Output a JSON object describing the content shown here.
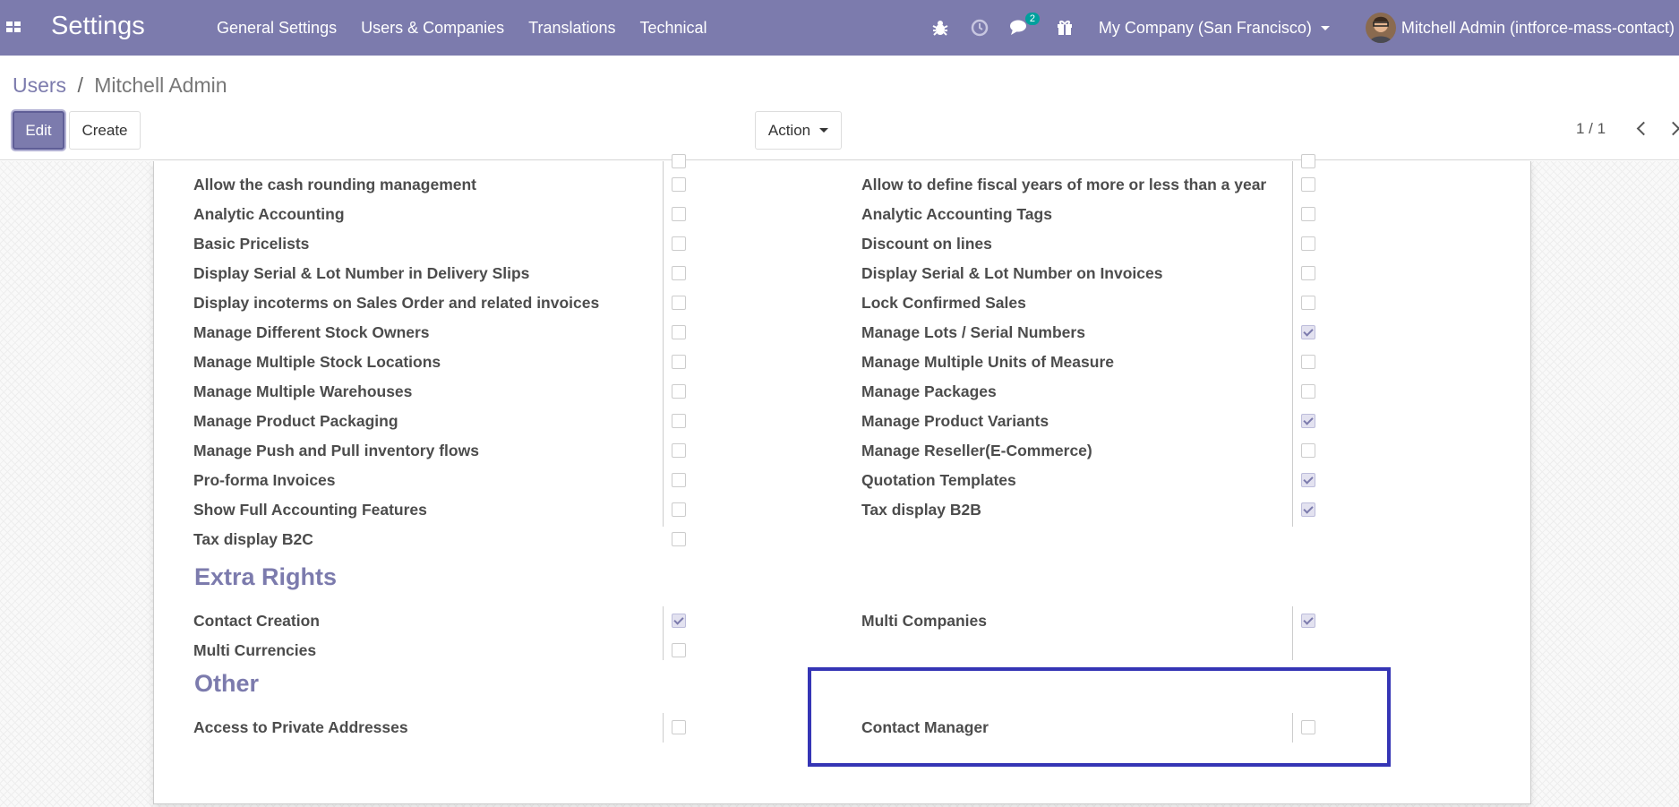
{
  "navbar": {
    "brand": "Settings",
    "menu": [
      "General Settings",
      "Users & Companies",
      "Translations",
      "Technical"
    ],
    "messages_badge": "2",
    "company": "My Company (San Francisco)",
    "user": "Mitchell Admin (intforce-mass-contact)",
    "colors": {
      "navbar_bg": "#7c7bad",
      "badge_bg": "#00a09d"
    }
  },
  "breadcrumb": {
    "parent": "Users",
    "separator": "/",
    "current": "Mitchell Admin"
  },
  "buttons": {
    "edit": "Edit",
    "create": "Create",
    "action": "Action"
  },
  "pager": {
    "value": "1 / 1"
  },
  "technical_left": [
    {
      "label": "Allow the cash rounding management",
      "checked": false
    },
    {
      "label": "Analytic Accounting",
      "checked": false
    },
    {
      "label": "Basic Pricelists",
      "checked": false
    },
    {
      "label": "Display Serial & Lot Number in Delivery Slips",
      "checked": false
    },
    {
      "label": "Display incoterms on Sales Order and related invoices",
      "checked": false
    },
    {
      "label": "Manage Different Stock Owners",
      "checked": false
    },
    {
      "label": "Manage Multiple Stock Locations",
      "checked": false
    },
    {
      "label": "Manage Multiple Warehouses",
      "checked": false
    },
    {
      "label": "Manage Product Packaging",
      "checked": false
    },
    {
      "label": "Manage Push and Pull inventory flows",
      "checked": false
    },
    {
      "label": "Pro-forma Invoices",
      "checked": false
    },
    {
      "label": "Show Full Accounting Features",
      "checked": false
    },
    {
      "label": "Tax display B2C",
      "checked": false
    }
  ],
  "technical_right": [
    {
      "label": "Allow to define fiscal years of more or less than a year",
      "checked": false
    },
    {
      "label": "Analytic Accounting Tags",
      "checked": false
    },
    {
      "label": "Discount on lines",
      "checked": false
    },
    {
      "label": "Display Serial & Lot Number on Invoices",
      "checked": false
    },
    {
      "label": "Lock Confirmed Sales",
      "checked": false
    },
    {
      "label": "Manage Lots / Serial Numbers",
      "checked": true
    },
    {
      "label": "Manage Multiple Units of Measure",
      "checked": false
    },
    {
      "label": "Manage Packages",
      "checked": false
    },
    {
      "label": "Manage Product Variants",
      "checked": true
    },
    {
      "label": "Manage Reseller(E-Commerce)",
      "checked": false
    },
    {
      "label": "Quotation Templates",
      "checked": true
    },
    {
      "label": "Tax display B2B",
      "checked": true
    }
  ],
  "extra_rights": {
    "title": "Extra Rights",
    "left": [
      {
        "label": "Contact Creation",
        "checked": true
      },
      {
        "label": "Multi Currencies",
        "checked": false
      }
    ],
    "right": [
      {
        "label": "Multi Companies",
        "checked": true
      }
    ]
  },
  "other": {
    "title": "Other",
    "left": [
      {
        "label": "Access to Private Addresses",
        "checked": false
      }
    ],
    "right": [
      {
        "label": "Contact Manager",
        "checked": false
      }
    ]
  },
  "highlight_color": "#3535b5"
}
